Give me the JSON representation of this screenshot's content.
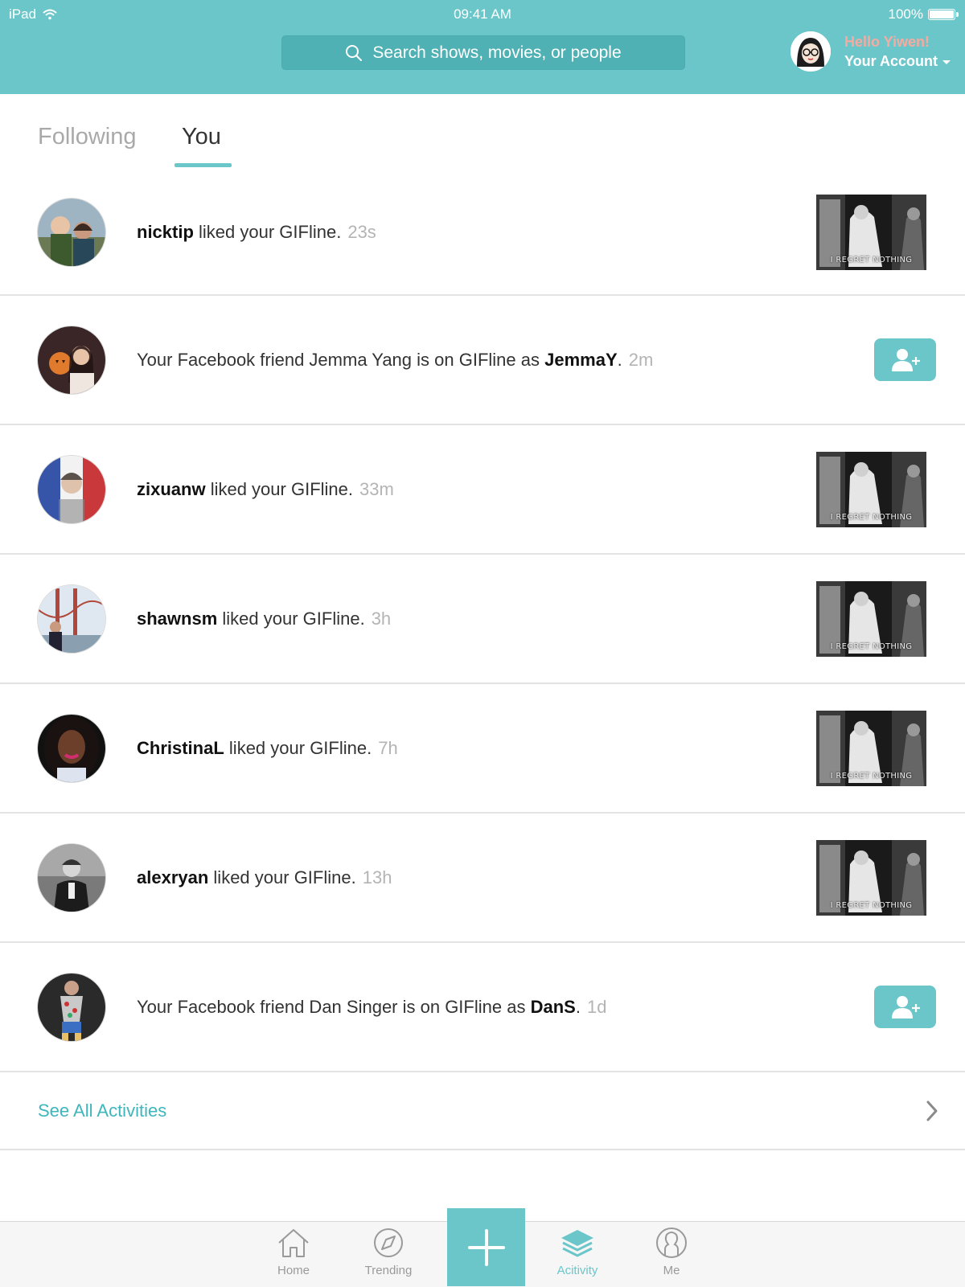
{
  "status_bar": {
    "carrier": "iPad",
    "time": "09:41 AM",
    "battery": "100%",
    "battery_level": 1.0
  },
  "search": {
    "placeholder": "Search shows, movies, or people",
    "icon": "search-icon"
  },
  "account": {
    "greeting": "Hello Yiwen!",
    "label": "Your Account"
  },
  "tabs": [
    {
      "label": "Following",
      "active": false
    },
    {
      "label": "You",
      "active": true
    }
  ],
  "activities": [
    {
      "user": "nicktip",
      "text": "liked your GIFline.",
      "time": "23s",
      "kind": "like"
    },
    {
      "prefix": "Your Facebook friend Jemma Yang is on GIFline as",
      "user": "JemmaY",
      "suffix": ".",
      "time": "2m",
      "kind": "friend"
    },
    {
      "user": "zixuanw",
      "text": "liked your GIFline.",
      "time": "33m",
      "kind": "like"
    },
    {
      "user": "shawnsm",
      "text": "liked your GIFline.",
      "time": "3h",
      "kind": "like"
    },
    {
      "user": "ChristinaL",
      "text": "liked your GIFline.",
      "time": "7h",
      "kind": "like"
    },
    {
      "user": "alexryan",
      "text": "liked your GIFline.",
      "time": "13h",
      "kind": "like"
    },
    {
      "prefix": "Your Facebook friend Dan Singer is on GIFline as",
      "user": "DanS",
      "suffix": ".",
      "time": "1d",
      "kind": "friend"
    }
  ],
  "gif_caption": "I REGRET NOTHING",
  "see_all": {
    "label": "See All Activities"
  },
  "tabbar": {
    "home": "Home",
    "trending": "Trending",
    "activity": "Acitivity",
    "me": "Me"
  },
  "colors": {
    "accent": "#6bc6c9",
    "link": "#3fb6bc",
    "greeting": "#f6aaa0"
  }
}
